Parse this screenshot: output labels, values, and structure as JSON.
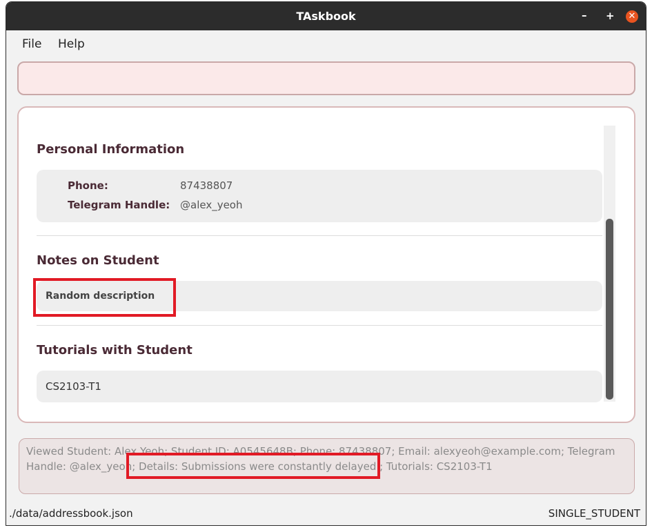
{
  "window": {
    "title": "TAskbook",
    "minimize": "–",
    "maximize": "+",
    "close": "✕"
  },
  "menu": {
    "file": "File",
    "help": "Help"
  },
  "command_box": {
    "value": ""
  },
  "sections": {
    "personal": {
      "title": "Personal Information",
      "phone_label": "Phone:",
      "phone_value": "87438807",
      "telegram_label": "Telegram Handle:",
      "telegram_value": "@alex_yeoh"
    },
    "notes": {
      "title": "Notes on Student",
      "text": "Random description"
    },
    "tutorials": {
      "title": "Tutorials with Student",
      "items": [
        "CS2103-T1"
      ]
    }
  },
  "result_display": {
    "text": "Viewed Student: Alex Yeoh; Student ID: A0545648B; Phone: 87438807; Email: alexyeoh@example.com; Telegram Handle: @alex_yeoh; Details: Submissions were constantly delayed.; Tutorials: CS2103-T1"
  },
  "status_bar": {
    "file_path": "./data/addressbook.json",
    "mode": "SINGLE_STUDENT"
  },
  "colors": {
    "accent_close": "#e95420",
    "highlight": "#e11a25",
    "heading": "#4a2a35"
  }
}
